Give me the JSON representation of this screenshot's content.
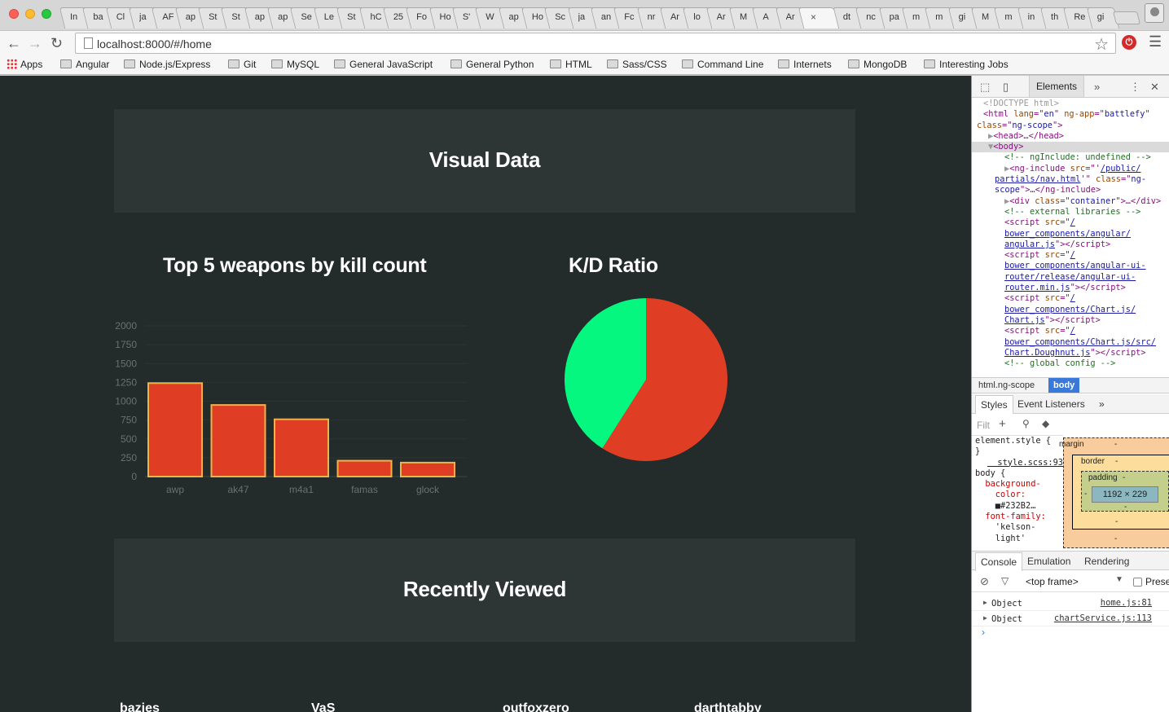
{
  "browser": {
    "tabs": [
      "In",
      "ba",
      "Cl",
      "ja",
      "AF",
      "ap",
      "St",
      "St",
      "ap",
      "ap",
      "Se",
      "Le",
      "St",
      "hC",
      "25",
      "Fo",
      "Ho",
      "S'",
      "W",
      "ap",
      "Ho",
      "Sc",
      "ja",
      "an",
      "Fc",
      "nr",
      "Ar",
      "lo",
      "Ar",
      "M",
      "A",
      "Ar",
      "",
      "dt",
      "nc",
      "pa",
      "m",
      "m",
      "gi",
      "M",
      "m",
      "in",
      "th",
      "Re",
      "gi"
    ],
    "active_tab_index": 32,
    "active_tab_close": "×",
    "url": "localhost:8000/#/home",
    "bookmarks": [
      "Apps",
      "Angular",
      "Node.js/Express",
      "Git",
      "MySQL",
      "General JavaScript",
      "General Python",
      "HTML",
      "Sass/CSS",
      "Command Line",
      "Internets",
      "MongoDB",
      "Interesting Jobs"
    ]
  },
  "page": {
    "visual_data_heading": "Visual Data",
    "bar_chart_title": "Top 5 weapons by kill count",
    "pie_chart_title": "K/D Ratio",
    "recently_viewed_heading": "Recently Viewed",
    "recent_users": [
      "bazies",
      "VaS",
      "outfoxzero",
      "darthtabby"
    ]
  },
  "chart_data": [
    {
      "type": "bar",
      "title": "Top 5 weapons by kill count",
      "categories": [
        "awp",
        "ak47",
        "m4a1",
        "famas",
        "glock"
      ],
      "values": [
        1240,
        950,
        760,
        210,
        185
      ],
      "y_ticks": [
        "0",
        "250",
        "500",
        "750",
        "1000",
        "1250",
        "1500",
        "1750",
        "2000"
      ],
      "ylim": [
        0,
        2000
      ],
      "colors": {
        "fill": "#e03e24",
        "stroke": "#f0b24a"
      }
    },
    {
      "type": "pie",
      "title": "K/D Ratio",
      "values": [
        59,
        41
      ],
      "colors": [
        "#e03e24",
        "#06f77f"
      ]
    }
  ],
  "devtools": {
    "panel_tab": "Elements",
    "more_tabs": "»",
    "dom_lines": [
      {
        "indent": 1,
        "html": "<span class='c-gray'>&lt;!DOCTYPE html&gt;</span>"
      },
      {
        "indent": 1,
        "html": "&lt;html <span class='c-attr'>lang</span>=\"<span class='c-val'>en</span>\" <span class='c-attr'>ng-app</span>=\"<span class='c-val'>battlefy</span>\""
      },
      {
        "indent": 0,
        "html": "<span class='c-attr'>class</span>=\"<span class='c-val'>ng-scope</span>\"&gt;"
      },
      {
        "indent": 2,
        "html": "<span class='c-gray'>▶</span>&lt;head&gt;…&lt;/head&gt;"
      },
      {
        "indent": 2,
        "html": "<span class='c-gray'>▼</span>&lt;body&gt;",
        "selected": true
      },
      {
        "indent": 3,
        "html": "<span class='c-comment'>&lt;!-- ngInclude: undefined --&gt;</span>"
      },
      {
        "indent": 3,
        "html": "<span class='c-gray'>▶</span>&lt;ng-include <span class='c-attr'>src</span>=\"'<span class='c-link'>/public/</span>"
      },
      {
        "indent": 4,
        "html": "<span class='c-link'>partials/nav.html</span>'\" <span class='c-attr'>class</span>=\"<span class='c-val'>ng-</span>"
      },
      {
        "indent": 4,
        "html": "<span class='c-val'>scope</span>\"&gt;…&lt;/ng-include&gt;"
      },
      {
        "indent": 3,
        "html": "<span class='c-gray'>▶</span>&lt;div <span class='c-attr'>class</span>=\"<span class='c-val'>container</span>\"&gt;…&lt;/div&gt;"
      },
      {
        "indent": 3,
        "html": "<span class='c-comment'>&lt;!-- external libraries --&gt;</span>"
      },
      {
        "indent": 3,
        "html": "&lt;script <span class='c-attr'>src</span>=\"<span class='c-link'>/</span>"
      },
      {
        "indent": 3,
        "html": "<span class='c-link'>bower_components/angular/</span>"
      },
      {
        "indent": 3,
        "html": "<span class='c-link'>angular.js</span>\"&gt;&lt;/script&gt;"
      },
      {
        "indent": 3,
        "html": "&lt;script <span class='c-attr'>src</span>=\"<span class='c-link'>/</span>"
      },
      {
        "indent": 3,
        "html": "<span class='c-link'>bower_components/angular-ui-</span>"
      },
      {
        "indent": 3,
        "html": "<span class='c-link'>router/release/angular-ui-</span>"
      },
      {
        "indent": 3,
        "html": "<span class='c-link'>router.min.js</span>\"&gt;&lt;/script&gt;"
      },
      {
        "indent": 3,
        "html": "&lt;script <span class='c-attr'>src</span>=\"<span class='c-link'>/</span>"
      },
      {
        "indent": 3,
        "html": "<span class='c-link'>bower_components/Chart.js/</span>"
      },
      {
        "indent": 3,
        "html": "<span class='c-link'>Chart.js</span>\"&gt;&lt;/script&gt;"
      },
      {
        "indent": 3,
        "html": "&lt;script <span class='c-attr'>src</span>=\"<span class='c-link'>/</span>"
      },
      {
        "indent": 3,
        "html": "<span class='c-link'>bower_components/Chart.js/src/</span>"
      },
      {
        "indent": 3,
        "html": "<span class='c-link'>Chart.Doughnut.js</span>\"&gt;&lt;/script&gt;"
      },
      {
        "indent": 3,
        "html": "<span class='c-comment'>&lt;!-- global config --&gt;</span>"
      }
    ],
    "breadcrumb_html": "html.ng-scope",
    "breadcrumb_body": "body",
    "styles_tab": "Styles",
    "event_listeners_tab": "Event Listeners",
    "filter_placeholder": "Filt",
    "rules_lines": [
      "element.style {",
      "}",
      "",
      "  style.scss:93",
      "body {",
      "  background-",
      "    color:",
      "    ■#232B2…",
      "  font-family:",
      "    'kelson-",
      "    light'"
    ],
    "box_model": {
      "margin": "margin",
      "border": "border",
      "padding": "padding",
      "content": "1192 × 229",
      "dash": "-"
    },
    "console_tabs": [
      "Console",
      "Emulation",
      "Rendering"
    ],
    "frame_selector": "<top frame>",
    "preserve_log": "Prese",
    "console_entries": [
      {
        "label": "Object",
        "source": "home.js:81"
      },
      {
        "label": "Object",
        "source": "chartService.js:113"
      }
    ],
    "prompt": "›"
  }
}
